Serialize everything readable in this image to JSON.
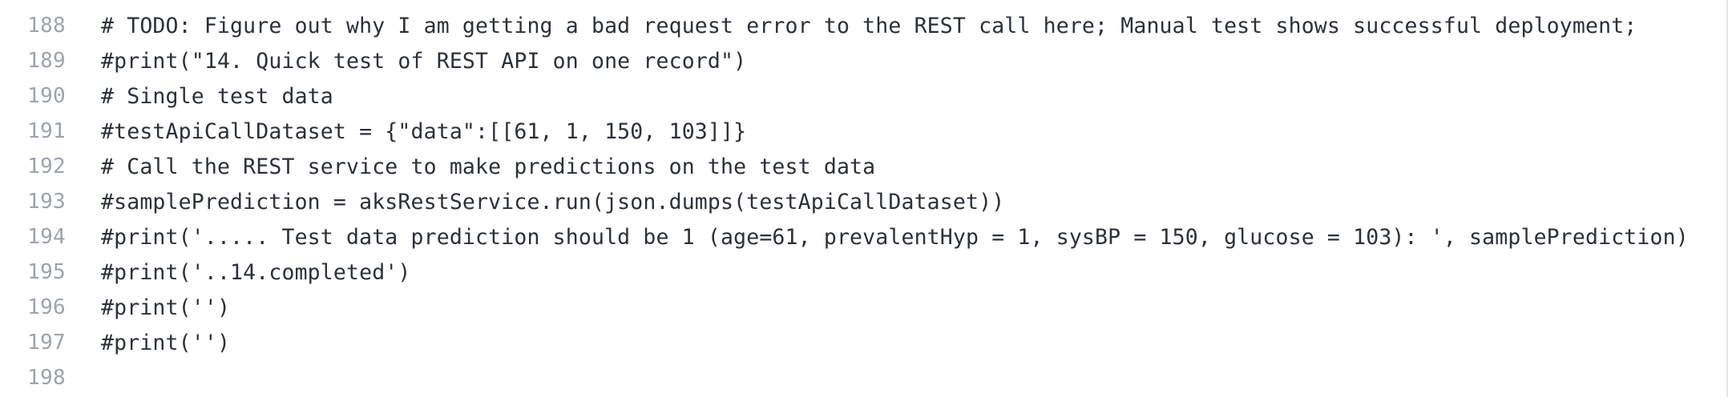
{
  "code_view": {
    "lines": [
      {
        "number": "188",
        "code": "# TODO: Figure out why I am getting a bad request error to the REST call here; Manual test shows successful deployment;"
      },
      {
        "number": "189",
        "code": "#print(\"14. Quick test of REST API on one record\")"
      },
      {
        "number": "190",
        "code": "# Single test data"
      },
      {
        "number": "191",
        "code": "#testApiCallDataset = {\"data\":[[61, 1, 150, 103]]}"
      },
      {
        "number": "192",
        "code": "# Call the REST service to make predictions on the test data"
      },
      {
        "number": "193",
        "code": "#samplePrediction = aksRestService.run(json.dumps(testApiCallDataset))"
      },
      {
        "number": "194",
        "code": "#print('..... Test data prediction should be 1 (age=61, prevalentHyp = 1, sysBP = 150, glucose = 103): ', samplePrediction)"
      },
      {
        "number": "195",
        "code": "#print('..14.completed')"
      },
      {
        "number": "196",
        "code": "#print('')"
      },
      {
        "number": "197",
        "code": "#print('')"
      },
      {
        "number": "198",
        "code": ""
      }
    ]
  },
  "colors": {
    "background": "#ffffff",
    "line_number": "#9ea3ab",
    "code_text": "#2c3138"
  }
}
